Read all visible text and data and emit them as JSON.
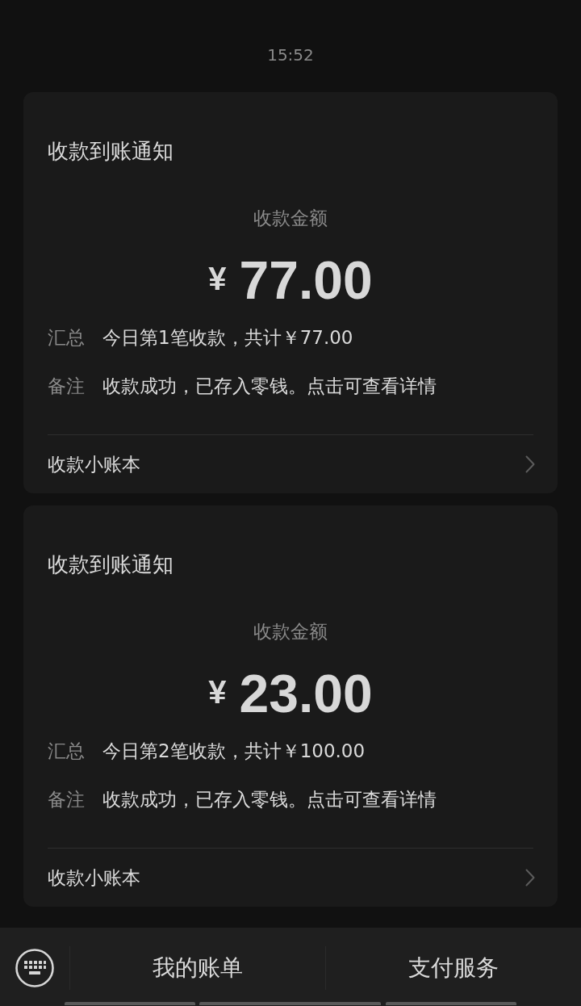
{
  "time": "15:52",
  "messages": [
    {
      "title": "收款到账通知",
      "amount_label": "收款金额",
      "currency": "¥",
      "amount": "77.00",
      "details": [
        {
          "label": "汇总",
          "value": "今日第1笔收款，共计￥77.00"
        },
        {
          "label": "备注",
          "value": "收款成功，已存入零钱。点击可查看详情"
        }
      ],
      "link": "收款小账本"
    },
    {
      "title": "收款到账通知",
      "amount_label": "收款金额",
      "currency": "¥",
      "amount": "23.00",
      "details": [
        {
          "label": "汇总",
          "value": "今日第2笔收款，共计￥100.00"
        },
        {
          "label": "备注",
          "value": "收款成功，已存入零钱。点击可查看详情"
        }
      ],
      "link": "收款小账本"
    }
  ],
  "menu_bar": {
    "items": [
      {
        "label": "我的账单"
      },
      {
        "label": "支付服务"
      }
    ]
  }
}
